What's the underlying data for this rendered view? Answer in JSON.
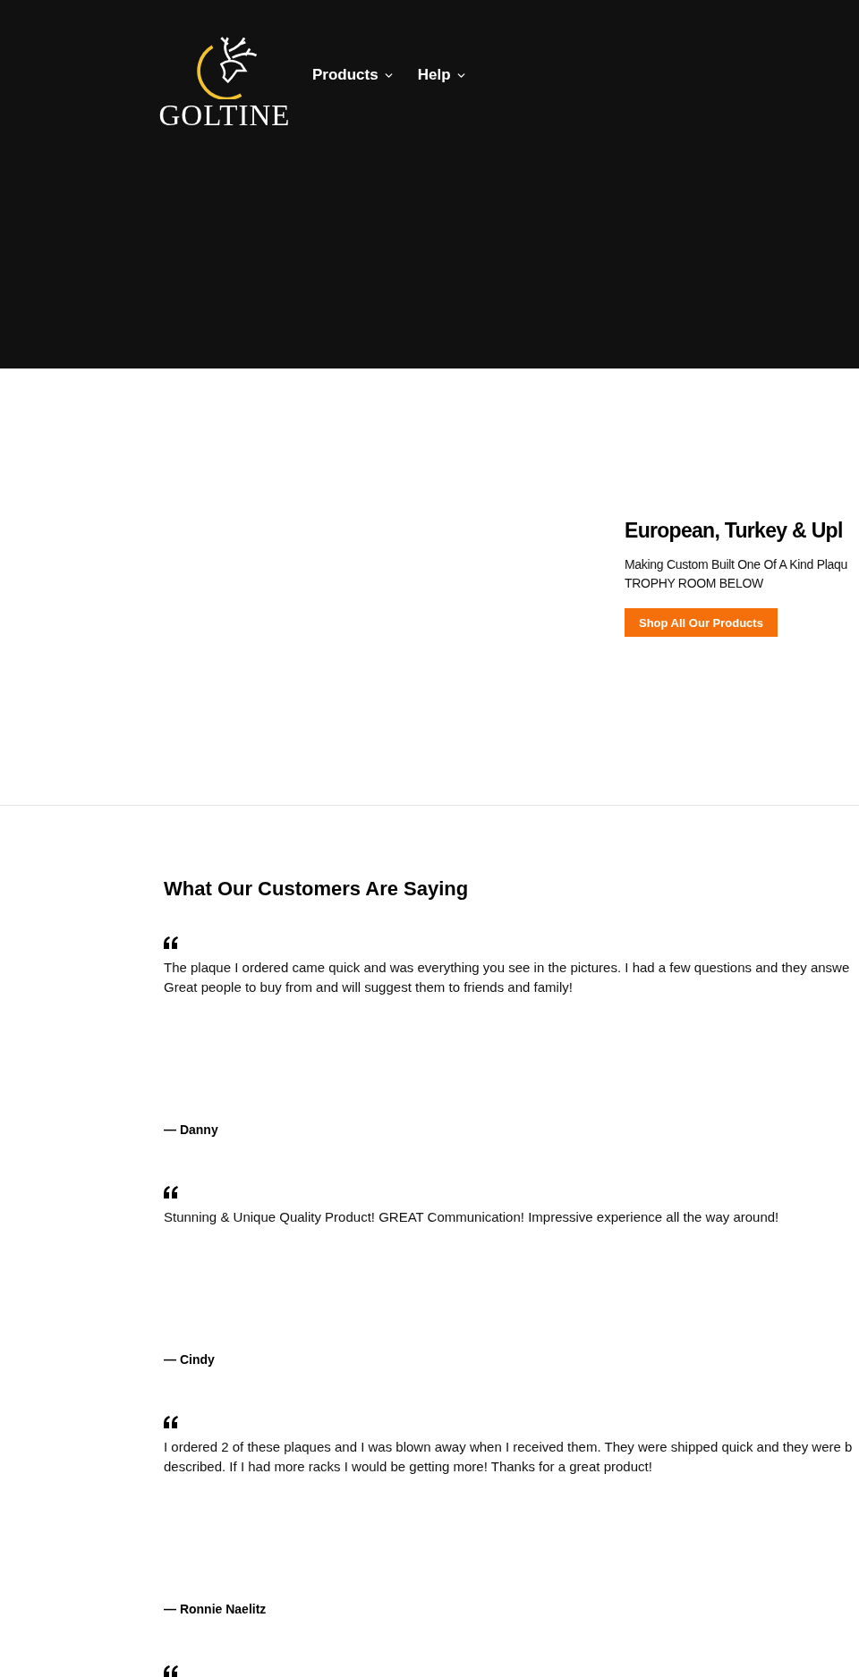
{
  "header": {
    "logo_text": "GOLTINE",
    "nav": [
      {
        "label": "Products",
        "has_menu": true
      },
      {
        "label": "Help",
        "has_menu": true
      }
    ]
  },
  "hero": {
    "title": "European, Turkey & Upl",
    "subtitle_lines": [
      "Making Custom Built One Of A Kind Plaqu",
      "TROPHY ROOM BELOW"
    ],
    "button": "Shop All Our Products"
  },
  "testimonials": {
    "title": "What Our Customers Are Saying",
    "items": [
      {
        "kind": "full",
        "quote_lines": [
          "The plaque I ordered came quick and was everything you see in the pictures. I had a few questions and they answe",
          "Great people to buy from and will suggest them to friends and family!"
        ],
        "author": "— Danny"
      },
      {
        "kind": "full",
        "quote_lines": [
          "Stunning & Unique Quality Product! GREAT Communication! Impressive experience all the way around!"
        ],
        "author": "— Cindy"
      },
      {
        "kind": "full",
        "quote_lines": [
          "I ordered 2 of these plaques and I was blown away when I received them. They were shipped quick and they were b",
          "described. If I had more racks I would be getting more! Thanks for a great product!"
        ],
        "author": "— Ronnie Naelitz"
      },
      {
        "kind": "cut"
      }
    ]
  }
}
